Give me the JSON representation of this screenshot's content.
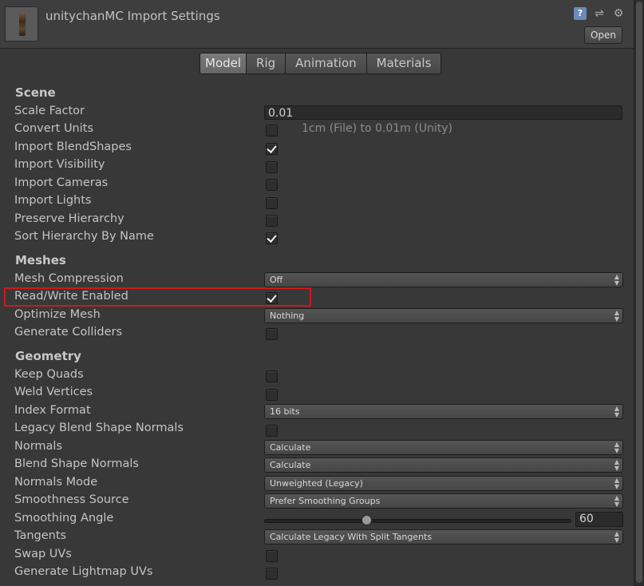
{
  "header": {
    "title": "unitychanMC Import Settings",
    "open_label": "Open"
  },
  "tabs": [
    "Model",
    "Rig",
    "Animation",
    "Materials"
  ],
  "sections": {
    "scene": "Scene",
    "meshes": "Meshes",
    "geometry": "Geometry"
  },
  "scene": {
    "scale_factor_label": "Scale Factor",
    "scale_factor_value": "0.01",
    "convert_units_label": "Convert Units",
    "convert_units_note": "1cm (File) to 0.01m (Unity)",
    "import_blendshapes_label": "Import BlendShapes",
    "import_visibility_label": "Import Visibility",
    "import_cameras_label": "Import Cameras",
    "import_lights_label": "Import Lights",
    "preserve_hierarchy_label": "Preserve Hierarchy",
    "sort_hierarchy_label": "Sort Hierarchy By Name"
  },
  "meshes": {
    "mesh_compression_label": "Mesh Compression",
    "mesh_compression_value": "Off",
    "read_write_label": "Read/Write Enabled",
    "optimize_mesh_label": "Optimize Mesh",
    "optimize_mesh_value": "Nothing",
    "generate_colliders_label": "Generate Colliders"
  },
  "geometry": {
    "keep_quads_label": "Keep Quads",
    "weld_vertices_label": "Weld Vertices",
    "index_format_label": "Index Format",
    "index_format_value": "16 bits",
    "legacy_blend_label": "Legacy Blend Shape Normals",
    "normals_label": "Normals",
    "normals_value": "Calculate",
    "blend_normals_label": "Blend Shape Normals",
    "blend_normals_value": "Calculate",
    "normals_mode_label": "Normals Mode",
    "normals_mode_value": "Unweighted (Legacy)",
    "smoothness_source_label": "Smoothness Source",
    "smoothness_source_value": "Prefer Smoothing Groups",
    "smoothing_angle_label": "Smoothing Angle",
    "smoothing_angle_value": "60",
    "tangents_label": "Tangents",
    "tangents_value": "Calculate Legacy With Split Tangents",
    "swap_uvs_label": "Swap UVs",
    "generate_lightmap_label": "Generate Lightmap UVs"
  },
  "checkbox_states": {
    "convert_units": false,
    "import_blendshapes": true,
    "import_visibility": false,
    "import_cameras": false,
    "import_lights": false,
    "preserve_hierarchy": false,
    "sort_hierarchy": true,
    "read_write": true,
    "generate_colliders": false,
    "keep_quads": false,
    "weld_vertices": false,
    "legacy_blend": false,
    "swap_uvs": false,
    "generate_lightmap": false
  },
  "smoothing_angle_fraction": 0.333,
  "highlight_color": "#cc1a1a"
}
